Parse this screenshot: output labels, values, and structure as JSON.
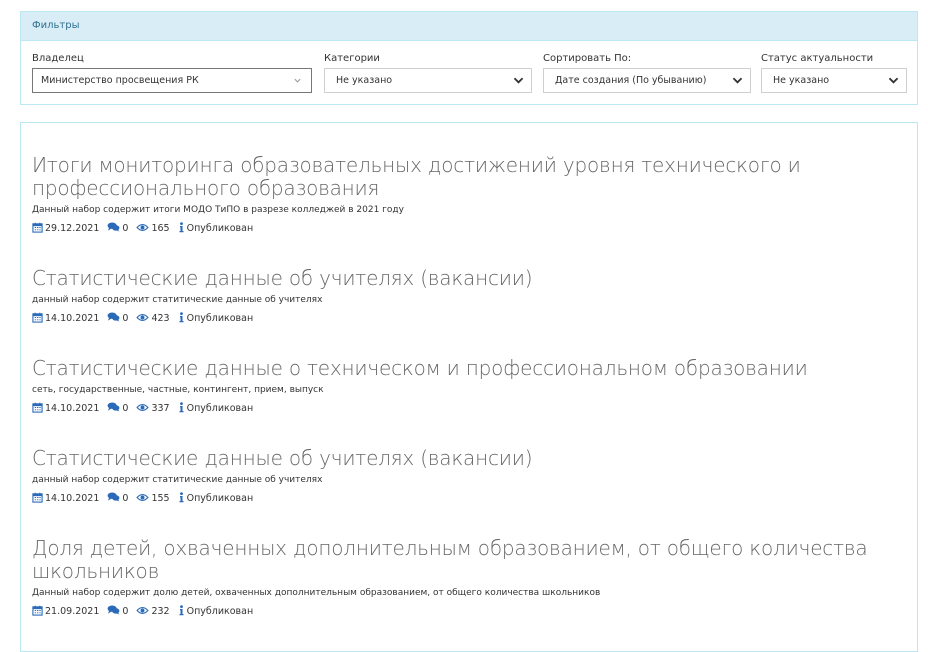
{
  "filters": {
    "header": "Фильтры",
    "owner": {
      "label": "Владелец",
      "value": "Министерство просвещения РК"
    },
    "category": {
      "label": "Категории",
      "value": "Не указано"
    },
    "sort": {
      "label": "Сортировать По:",
      "value": "Дате создания (По убыванию)"
    },
    "status": {
      "label": "Статус актуальности",
      "value": "Не указано"
    }
  },
  "items": [
    {
      "title": "Итоги мониторинга образовательных достижений уровня технического и профессионального образования",
      "description": "Данный набор содержит итоги МОДО ТиПО в разрезе колледжей в 2021 году",
      "date": "29.12.2021",
      "comments": "0",
      "views": "165",
      "status": "Опубликован"
    },
    {
      "title": "Статистические данные об учителях (вакансии)",
      "description": "данный набор содержит статитические данные об учителях",
      "date": "14.10.2021",
      "comments": "0",
      "views": "423",
      "status": "Опубликован"
    },
    {
      "title": "Статистические данные о техническом и профессиональном образовании",
      "description": "сеть, государственные, частные, контингент, прием, выпуск",
      "date": "14.10.2021",
      "comments": "0",
      "views": "337",
      "status": "Опубликован"
    },
    {
      "title": "Статистические данные об учителях (вакансии)",
      "description": "данный набор содержит статитические данные об учителях",
      "date": "14.10.2021",
      "comments": "0",
      "views": "155",
      "status": "Опубликован"
    },
    {
      "title": "Доля детей, охваченных дополнительным образованием, от общего количества школьников",
      "description": "Данный набор содержит долю детей, охваченных дополнительным образованием, от общего количества школьников",
      "date": "21.09.2021",
      "comments": "0",
      "views": "232",
      "status": "Опубликован"
    }
  ],
  "icons": {
    "date": "calendar-icon",
    "comments": "comments-icon",
    "views": "eye-icon",
    "status": "info-icon"
  },
  "colors": {
    "accent": "#2b6ab8",
    "panel_header_bg": "#d9edf7",
    "panel_border": "#bce8f1",
    "title": "#666666"
  }
}
